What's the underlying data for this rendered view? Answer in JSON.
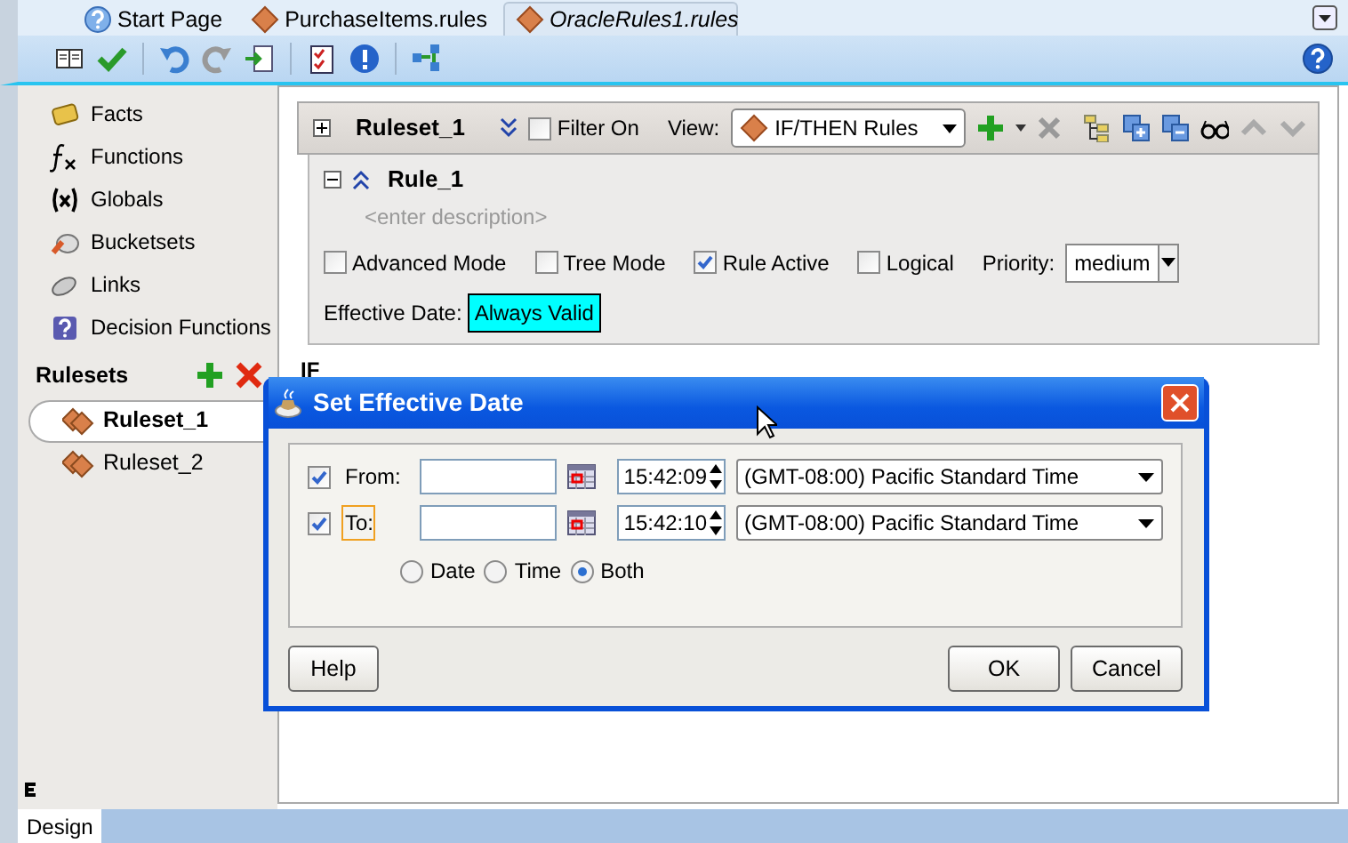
{
  "tabs": [
    {
      "label": "Start Page",
      "kind": "help",
      "selected": false
    },
    {
      "label": "PurchaseItems.rules",
      "kind": "rules",
      "selected": false
    },
    {
      "label": "OracleRules1.rules",
      "kind": "rules",
      "selected": true
    }
  ],
  "sidebar": {
    "items": [
      {
        "label": "Facts",
        "kind": "facts"
      },
      {
        "label": "Functions",
        "kind": "functions"
      },
      {
        "label": "Globals",
        "kind": "globals"
      },
      {
        "label": "Bucketsets",
        "kind": "bucketsets"
      },
      {
        "label": "Links",
        "kind": "links"
      },
      {
        "label": "Decision Functions",
        "kind": "decision"
      }
    ],
    "rulesets_title": "Rulesets",
    "rulesets": [
      {
        "label": "Ruleset_1",
        "selected": true
      },
      {
        "label": "Ruleset_2",
        "selected": false
      }
    ]
  },
  "ruleset": {
    "name": "Ruleset_1",
    "filter": {
      "label": "Filter On",
      "checked": false
    },
    "view_label": "View:",
    "view_value": "IF/THEN Rules"
  },
  "rule": {
    "name": "Rule_1",
    "description": "<enter description>",
    "options": [
      {
        "label": "Advanced Mode",
        "checked": false
      },
      {
        "label": "Tree Mode",
        "checked": false
      },
      {
        "label": "Rule Active",
        "checked": true
      },
      {
        "label": "Logical",
        "checked": false
      }
    ],
    "priority_label": "Priority:",
    "priority": "medium",
    "effective_date_label": "Effective Date:",
    "effective_date": "Always Valid"
  },
  "if_label": "IF",
  "dialog": {
    "title": "Set Effective Date",
    "rows": [
      {
        "label": "From:",
        "checked": true,
        "focused": false,
        "time": "15:42:09",
        "timezone": "(GMT-08:00) Pacific Standard Time"
      },
      {
        "label": "To:",
        "checked": true,
        "focused": true,
        "time": "15:42:10",
        "timezone": "(GMT-08:00) Pacific Standard Time"
      }
    ],
    "modes": [
      {
        "label": "Date",
        "selected": false
      },
      {
        "label": "Time",
        "selected": false
      },
      {
        "label": "Both",
        "selected": true
      }
    ],
    "buttons": [
      {
        "label": "Help",
        "kind": "help"
      },
      {
        "label": "OK",
        "kind": "ok"
      },
      {
        "label": "Cancel",
        "kind": "cancel"
      }
    ]
  },
  "bottom_tabs": [
    {
      "label": "Design",
      "selected": true
    }
  ]
}
